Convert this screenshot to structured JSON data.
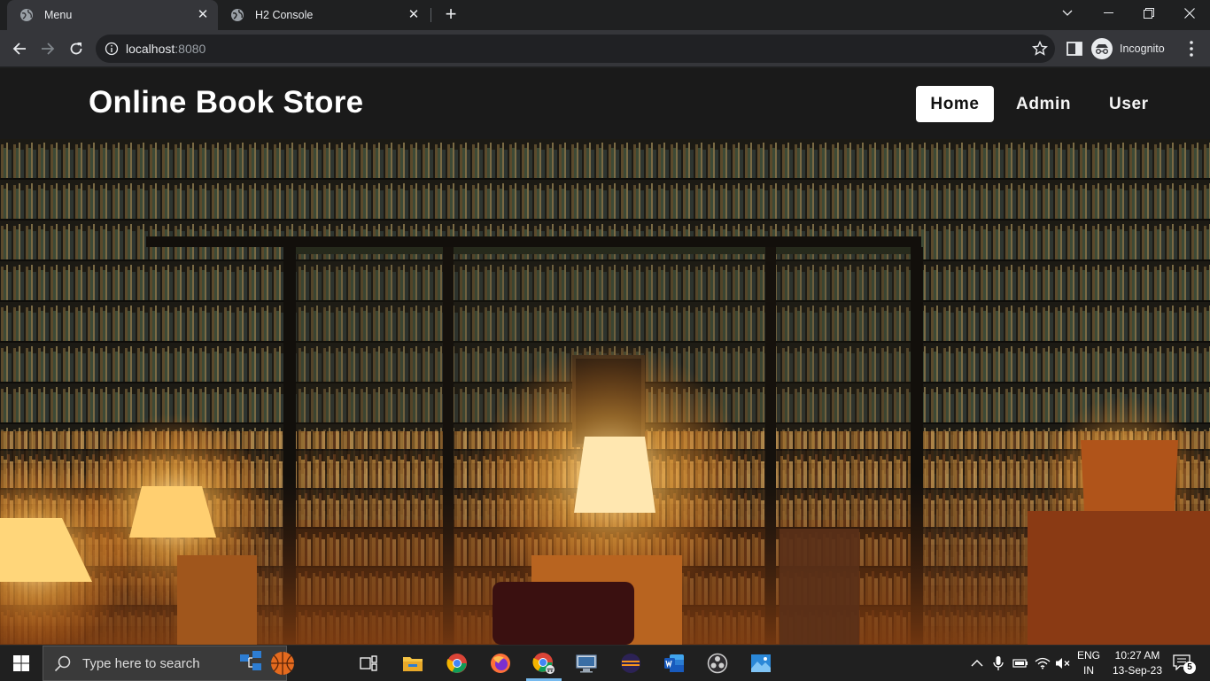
{
  "browser": {
    "tabs": [
      {
        "title": "Menu",
        "active": true
      },
      {
        "title": "H2 Console",
        "active": false
      }
    ],
    "url": {
      "host": "localhost",
      "port": ":8080"
    },
    "profile_label": "Incognito"
  },
  "site": {
    "brand": "Online Book Store",
    "nav": [
      {
        "label": "Home",
        "active": true
      },
      {
        "label": "Admin",
        "active": false
      },
      {
        "label": "User",
        "active": false
      }
    ]
  },
  "taskbar": {
    "search_placeholder": "Type here to search",
    "apps": [
      "task-view-icon",
      "file-explorer-icon",
      "chrome-icon",
      "firefox-icon",
      "chrome-incognito-icon",
      "remote-desktop-icon",
      "eclipse-icon",
      "word-icon",
      "obs-icon",
      "photos-icon"
    ],
    "language": "ENG",
    "region": "IN",
    "time": "10:27 AM",
    "date": "13-Sep-23",
    "notification_count": "5"
  },
  "colors": {
    "header_bg": "#1a1a1a",
    "active_nav_bg": "#ffffff",
    "chrome_bg": "#35363a",
    "taskbar_bg": "#202020"
  }
}
